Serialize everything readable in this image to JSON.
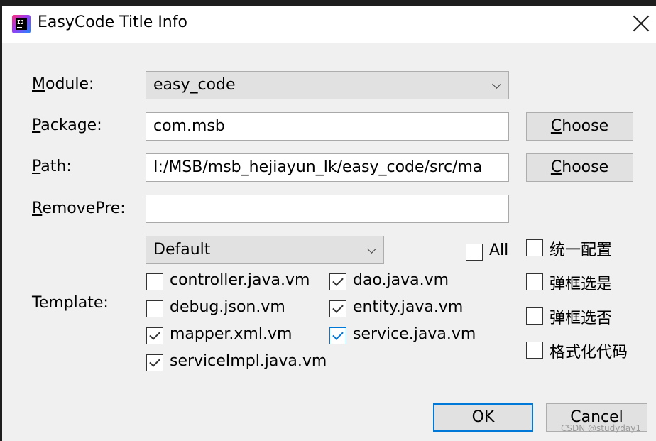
{
  "window": {
    "title": "EasyCode Title Info"
  },
  "form": {
    "module": {
      "label_first": "M",
      "label_rest": "odule:",
      "value": "easy_code"
    },
    "package": {
      "label_first": "P",
      "label_rest": "ackage:",
      "value": "com.msb",
      "button_first": "C",
      "button_rest": "hoose"
    },
    "path": {
      "label_first": "P",
      "label_rest": "ath:",
      "value": "I:/MSB/msb_hejiayun_lk/easy_code/src/ma",
      "button_first": "C",
      "button_rest": "hoose"
    },
    "remove_pre": {
      "label_first": "R",
      "label_rest": "emovePre:",
      "value": ""
    },
    "template": {
      "label": "Template:",
      "group": "Default",
      "all_label": "All",
      "all_checked": false,
      "items": [
        {
          "label": "controller.java.vm",
          "checked": false
        },
        {
          "label": "dao.java.vm",
          "checked": true
        },
        {
          "label": "debug.json.vm",
          "checked": false
        },
        {
          "label": "entity.java.vm",
          "checked": true
        },
        {
          "label": "mapper.xml.vm",
          "checked": true
        },
        {
          "label": "service.java.vm",
          "checked": true
        },
        {
          "label": "serviceImpl.java.vm",
          "checked": true
        }
      ]
    },
    "options": [
      {
        "label": "统一配置",
        "checked": false
      },
      {
        "label": "弹框选是",
        "checked": false
      },
      {
        "label": "弹框选否",
        "checked": false
      },
      {
        "label": "格式化代码",
        "checked": false
      }
    ]
  },
  "buttons": {
    "ok": "OK",
    "cancel": "Cancel"
  },
  "watermark": "CSDN @studyday1",
  "colors": {
    "focus": "#0078d7",
    "dialog_bg": "#f0f0f0"
  }
}
